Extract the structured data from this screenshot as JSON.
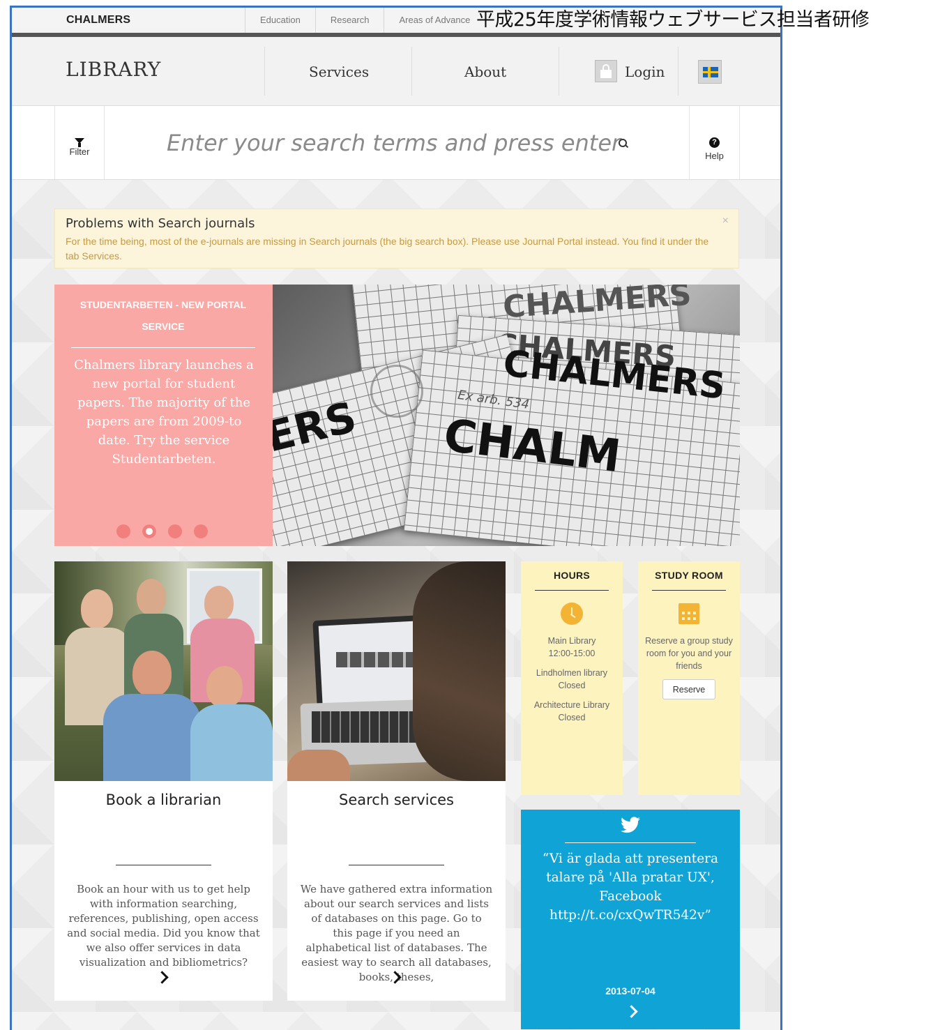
{
  "overlay_title": "平成25年度学術情報ウェブサービス担当者研修",
  "topbar": {
    "brand": "CHALMERS",
    "links": [
      "Education",
      "Research",
      "Areas of Advance"
    ]
  },
  "header": {
    "logo": "LIBRARY",
    "nav": {
      "services": "Services",
      "about": "About",
      "login": "Login"
    },
    "language_icon": "swedish-flag-icon"
  },
  "search": {
    "filter_label": "Filter",
    "placeholder": "Enter your search terms and press enter",
    "help_label": "Help"
  },
  "alert": {
    "title": "Problems with Search journals",
    "body": "For the time being, most of the e-journals are missing in Search journals (the big search box). Please use Journal Portal instead. You find it under the tab Services.",
    "close": "×"
  },
  "carousel": {
    "heading": "STUDENTARBETEN - NEW PORTAL SERVICE",
    "text": "Chalmers library launches a new portal for student papers. The majority of the papers are from 2009-to date. Try the service Studentarbeten.",
    "slides": 4,
    "active_slide": 2,
    "image_words": [
      "CHALMERS",
      "CHALMERS",
      "CHALMERS",
      "ERS",
      "CHALM",
      "Ex arb. 534"
    ]
  },
  "tiles": [
    {
      "title": "Book a librarian",
      "text": "Book an hour with us to get help with information searching, references, publishing, open access and social media. Did you know that we also offer services in data visualization and bibliometrics?"
    },
    {
      "title": "Search services",
      "text": "We have gathered extra information about our search services and lists of databases on this page. Go to this page if you need an alphabetical list of databases. The easiest way to search all databases, books, theses,"
    }
  ],
  "hours": {
    "title": "HOURS",
    "entries": [
      {
        "name": "Main Library",
        "status": "12:00-15:00"
      },
      {
        "name": "Lindholmen library",
        "status": "Closed"
      },
      {
        "name": "Architecture Library",
        "status": "Closed"
      }
    ]
  },
  "study_room": {
    "title": "STUDY ROOM",
    "text": "Reserve a group study room for you and your friends",
    "button": "Reserve"
  },
  "twitter": {
    "text": "“Vi är glada att presentera talare på 'Alla pratar UX', Facebook http://t.co/cxQwTR542v”",
    "date": "2013-07-04"
  },
  "colors": {
    "accent_pink": "#f9a8a5",
    "alert_bg": "#fcf4db",
    "yellow_box": "#fdf3bf",
    "twitter_blue": "#0fa3d6",
    "frame_blue": "#3a72c4"
  }
}
